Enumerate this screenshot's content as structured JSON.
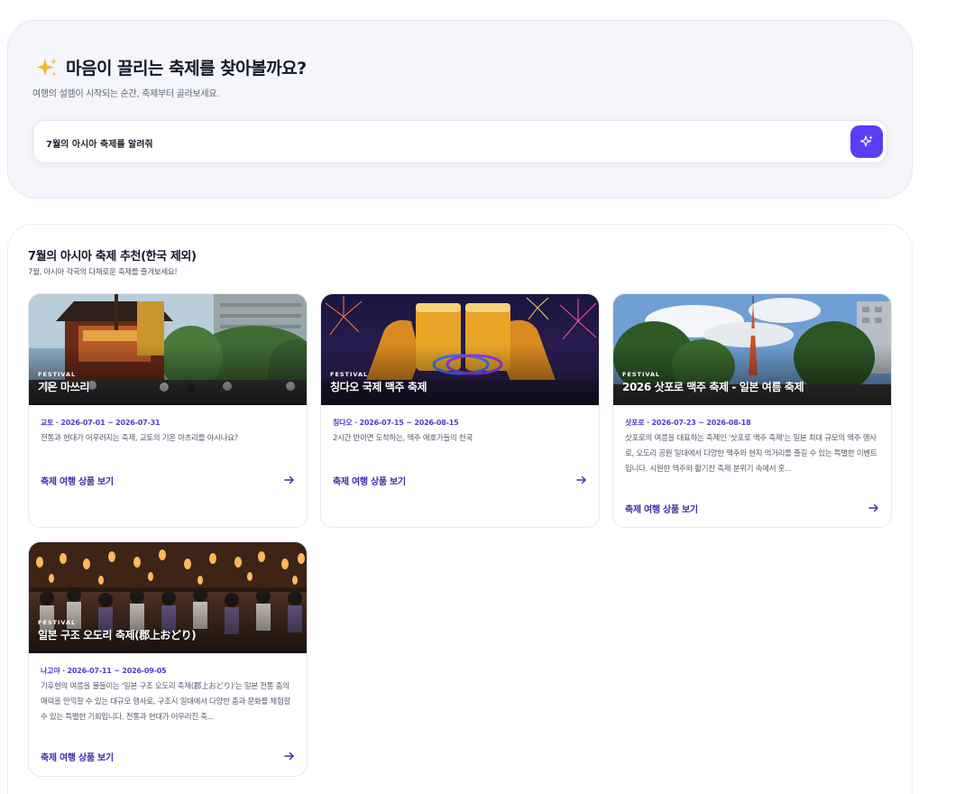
{
  "search": {
    "title": "마음이 끌리는 축제를 찾아볼까요?",
    "subtitle": "여행의 설렘이 시작되는 순간, 축제부터 골라보세요.",
    "query": "7월의 아시아 축제를 알려줘",
    "accent_color": "#5b3df5",
    "button_icon": "sparkle-icon"
  },
  "results": {
    "title": "7월의 아시아 축제 추천(한국 제외)",
    "subtitle": "7월, 아시아 각국의 다채로운 축제를 즐겨보세요!",
    "cards": [
      {
        "tag": "FESTIVAL",
        "name": "기온 마쓰리",
        "meta": "교토 · 2026-07-01 ~ 2026-07-31",
        "description": "전통과 현대가 어우러지는 축제, 교토의 기온 마츠리를 아시나요?",
        "link": "축제 여행 상품 보기"
      },
      {
        "tag": "FESTIVAL",
        "name": "칭다오 국제 맥주 축제",
        "meta": "칭다오 · 2026-07-15 ~ 2026-08-15",
        "description": "2시간 반이면 도착하는, 맥주 애호가들의 천국",
        "link": "축제 여행 상품 보기"
      },
      {
        "tag": "FESTIVAL",
        "name": "2026 삿포로 맥주 축제 - 일본 여름 축제",
        "meta": "삿포로 · 2026-07-23 ~ 2026-08-18",
        "description": "삿포로의 여름을 대표하는 축제인 '삿포로 맥주 축제'는 일본 최대 규모의 맥주 행사로, 오도리 공원 일대에서 다양한 맥주와 현지 먹거리를 즐길 수 있는 특별한 이벤트입니다. 시원한 맥주와 활기찬 축제 분위기 속에서 홋...",
        "link": "축제 여행 상품 보기"
      },
      {
        "tag": "FESTIVAL",
        "name": "일본 구조 오도리 축제(郡上おどり)",
        "meta": "나고야 · 2026-07-11 ~ 2026-09-05",
        "description": "기후현의 여름을 물들이는 '일본 구조 오도리 축제(郡上おどり)'는 일본 전통 춤의 매력을 만끽할 수 있는 대규모 행사로, 구조시 일대에서 다양한 춤과 문화를 체험할 수 있는 특별한 기회입니다. 전통과 현대가 어우러진 축...",
        "link": "축제 여행 상품 보기"
      }
    ]
  }
}
